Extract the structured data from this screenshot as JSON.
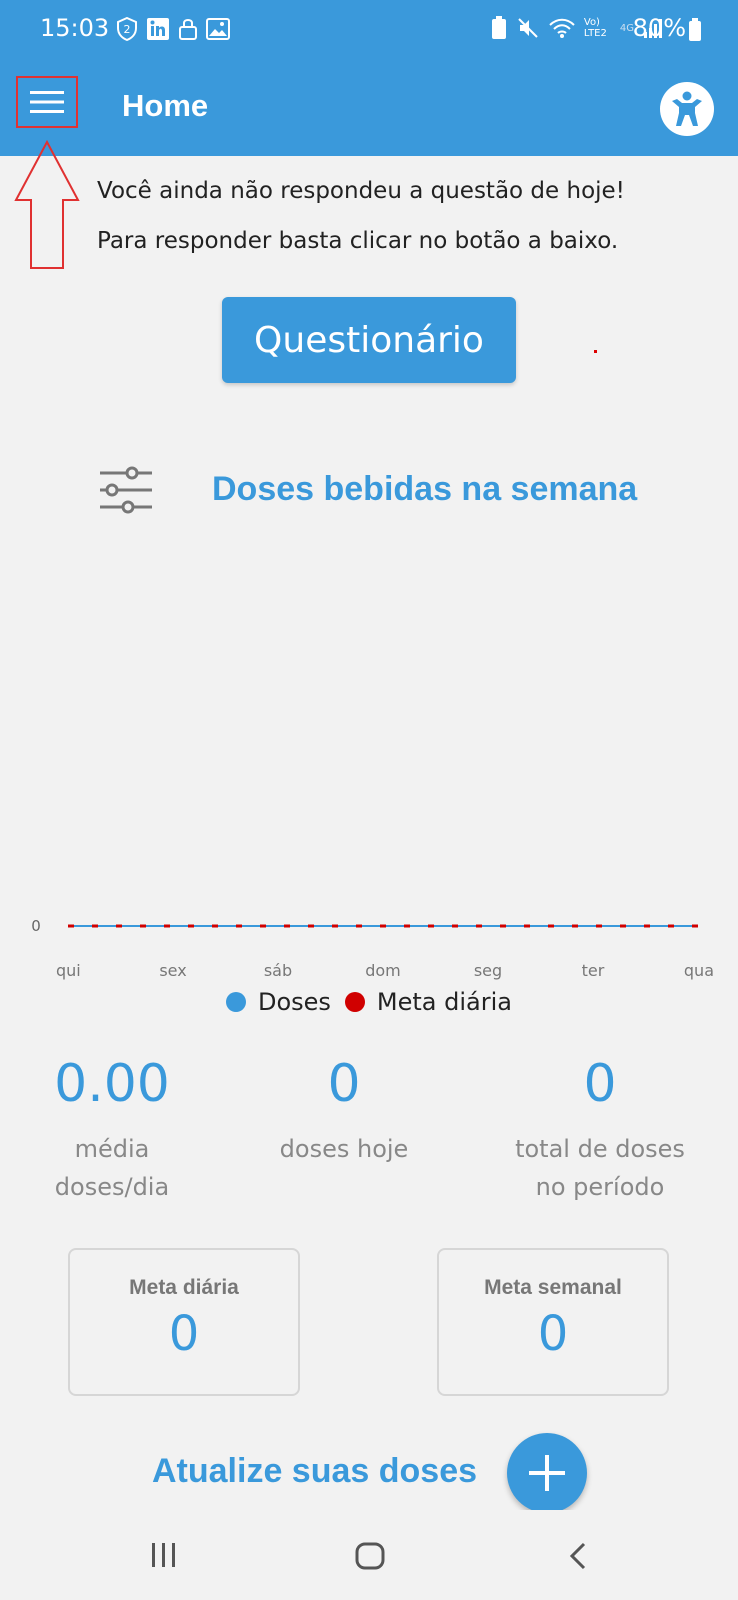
{
  "status_bar": {
    "time": "15:03",
    "battery": "80%",
    "left_icons": [
      "shield-2-icon",
      "linkedin-icon",
      "lock-icon",
      "image-icon"
    ],
    "right_icons": [
      "recycle-battery-icon",
      "mute-icon",
      "wifi-icon",
      "volte-icon",
      "signal-icon",
      "battery-icon"
    ],
    "network_label": "Vo) LTE2",
    "signal_label": "4G"
  },
  "app_bar": {
    "title": "Home",
    "menu_icon": "menu-icon",
    "accessibility_icon": "accessibility-icon",
    "color": "#3a99db"
  },
  "notice": {
    "line1": "Você ainda não respondeu a questão de hoje!",
    "line2": "Para responder basta clicar no botão a baixo."
  },
  "quiz_button": {
    "label": "Questionário"
  },
  "section": {
    "title": "Doses bebidas na semana",
    "filter_icon": "sliders-icon"
  },
  "chart_data": {
    "type": "line",
    "categories": [
      "qui",
      "sex",
      "sáb",
      "dom",
      "seg",
      "ter",
      "qua"
    ],
    "series": [
      {
        "name": "Doses",
        "values": [
          0,
          0,
          0,
          0,
          0,
          0,
          0
        ],
        "color": "#3a99db"
      },
      {
        "name": "Meta diária",
        "values": [
          0,
          0,
          0,
          0,
          0,
          0,
          0
        ],
        "color": "#d00000"
      }
    ],
    "y_tick_labels": [
      "0"
    ],
    "legend_position": "bottom"
  },
  "stats": [
    {
      "value": "0.00",
      "label_lines": [
        "média",
        "doses/dia"
      ]
    },
    {
      "value": "0",
      "label_lines": [
        "doses hoje"
      ]
    },
    {
      "value": "0",
      "label_lines": [
        "total de doses",
        "no período"
      ]
    }
  ],
  "goals": {
    "daily": {
      "title": "Meta diária",
      "value": "0"
    },
    "weekly": {
      "title": "Meta semanal",
      "value": "0"
    }
  },
  "update": {
    "label": "Atualize suas doses",
    "add_icon": "plus-icon"
  },
  "nav_bar": {
    "icons": [
      "recent-apps-icon",
      "home-icon",
      "back-icon"
    ]
  }
}
